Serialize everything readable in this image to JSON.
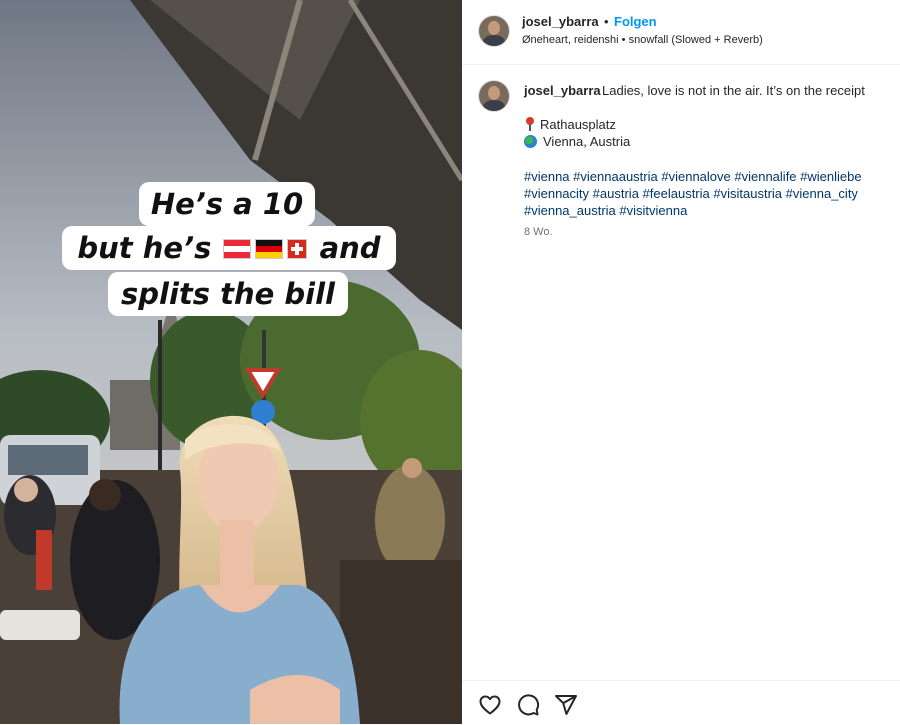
{
  "media": {
    "caption_line1": "He’s a 10",
    "caption_line2_pre": "but he’s",
    "caption_line2_post": "and",
    "caption_line3": "splits the bill",
    "flags": [
      "austria-flag-icon",
      "germany-flag-icon",
      "switzerland-flag-icon"
    ]
  },
  "header": {
    "username": "josel_ybarra",
    "separator": "•",
    "follow_label": "Folgen",
    "audio": "Øneheart, reidenshi • snowfall (Slowed + Reverb)"
  },
  "post": {
    "username": "josel_ybarra",
    "text": "Ladies, love is not in the air. It’s on the receipt",
    "location_1": "Rathausplatz",
    "location_2": "Vienna, Austria",
    "hashtags": [
      "#vienna",
      "#viennaaustria",
      "#viennalove",
      "#viennalife",
      "#wienliebe",
      "#viennacity",
      "#austria",
      "#feelaustria",
      "#visitaustria",
      "#vienna_city",
      "#vienna_austria",
      "#visitvienna"
    ],
    "time": "8 Wo."
  },
  "actions": [
    "heart-icon",
    "comment-icon",
    "share-icon"
  ],
  "colors": {
    "link": "#0095f6",
    "hashtag": "#00376b",
    "muted": "#737373"
  }
}
